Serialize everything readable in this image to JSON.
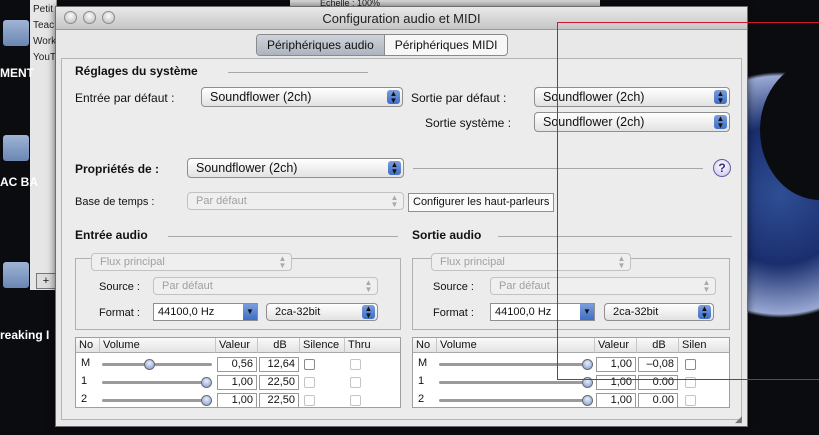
{
  "background": {
    "list_items": [
      "Petit",
      "Teac",
      "Work",
      "YouT"
    ],
    "labels": [
      "MENT",
      "AC BA",
      "reaking I"
    ],
    "back_window_text": "Échelle :   100%"
  },
  "window": {
    "title": "Configuration audio et MIDI",
    "tabs": [
      {
        "label": "Périphériques audio",
        "active": true
      },
      {
        "label": "Périphériques MIDI",
        "active": false
      }
    ]
  },
  "system": {
    "title": "Réglages du système",
    "input_default_label": "Entrée par défaut :",
    "input_default_value": "Soundflower (2ch)",
    "output_default_label": "Sortie par défaut :",
    "output_default_value": "Soundflower (2ch)",
    "system_output_label": "Sortie système :",
    "system_output_value": "Soundflower (2ch)"
  },
  "properties": {
    "label": "Propriétés de :",
    "value": "Soundflower (2ch)",
    "help": "?",
    "timebase_label": "Base de temps :",
    "timebase_value": "Par défaut",
    "configure_button": "Configurer les haut-parleurs"
  },
  "audio_in": {
    "title": "Entrée audio",
    "stream": "Flux principal",
    "source_label": "Source :",
    "source_value": "Par défaut",
    "format_label": "Format :",
    "rate": "44100,0 Hz",
    "bits": "2ca-32bit",
    "headers": [
      "No",
      "Volume",
      "Valeur",
      "dB",
      "Silence",
      "Thru"
    ],
    "rows": [
      {
        "no": "M",
        "level": 0.42,
        "value": "0,56",
        "db": "12,64"
      },
      {
        "no": "1",
        "level": 1.0,
        "value": "1,00",
        "db": "22,50"
      },
      {
        "no": "2",
        "level": 1.0,
        "value": "1,00",
        "db": "22,50"
      }
    ]
  },
  "audio_out": {
    "title": "Sortie audio",
    "stream": "Flux principal",
    "source_label": "Source :",
    "source_value": "Par défaut",
    "format_label": "Format :",
    "rate": "44100,0 Hz",
    "bits": "2ca-32bit",
    "headers": [
      "No",
      "Volume",
      "Valeur",
      "dB",
      "Silen"
    ],
    "rows": [
      {
        "no": "M",
        "level": 1.0,
        "value": "1,00",
        "db": "–0,08"
      },
      {
        "no": "1",
        "level": 1.0,
        "value": "1,00",
        "db": "0.00"
      },
      {
        "no": "2",
        "level": 1.0,
        "value": "1,00",
        "db": "0.00"
      }
    ]
  }
}
